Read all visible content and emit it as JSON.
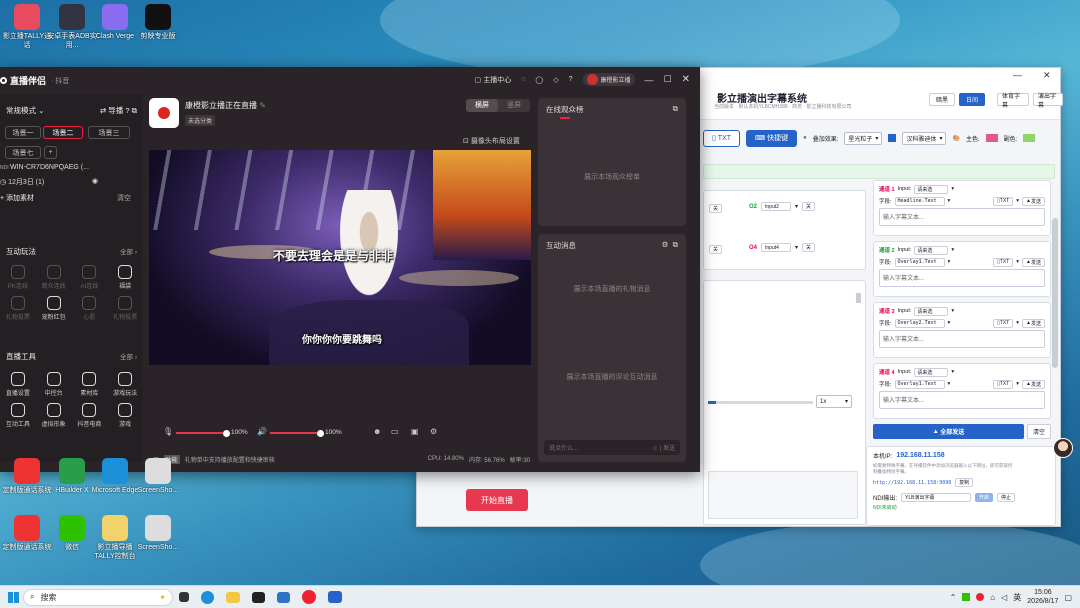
{
  "desktop": {
    "icons": [
      {
        "label": "影立播TALLY通话",
        "color": "#e84a5f"
      },
      {
        "label": "安卓手表ADB实用...",
        "color": "#334"
      },
      {
        "label": "Clash Verge",
        "color": "#8a6cf0"
      },
      {
        "label": "剪映专业版",
        "color": "#111"
      },
      {
        "label": "定制版通话系统",
        "color": "#e33"
      },
      {
        "label": "HBuilder X",
        "color": "#2a9d4a"
      },
      {
        "label": "Microsoft Edge",
        "color": "#1b8fd8"
      },
      {
        "label": "ScreenSho...",
        "color": "#ddd"
      },
      {
        "label": "定制版通话系统",
        "color": "#e33"
      },
      {
        "label": "微信",
        "color": "#2dc100"
      },
      {
        "label": "影立播导播TALLY控制台",
        "color": "#f2d36b"
      },
      {
        "label": "ScreenSho...",
        "color": "#ddd"
      }
    ]
  },
  "taskbar": {
    "search_label": "搜索",
    "tray_lang": "英",
    "time": "15:06",
    "date": "2026/8/17"
  },
  "live_app": {
    "title": "直播伴侣",
    "sub_title": "· 抖音",
    "header_links": [
      "主播中心"
    ],
    "user_name": "康橙影立播",
    "sidebar": {
      "mode_label": "常规模式",
      "guide_label": "导播",
      "scenes": [
        "场景一",
        "场景二",
        "场景三",
        "场景七"
      ],
      "active_scene": 1,
      "source_name": "WIN-CR7D6NPQAEG (...",
      "source_date": "12月3日 (1)",
      "add_material": "添加素材",
      "clear": "清空",
      "interact_title": "互动玩法",
      "all_label": "全部",
      "interact_items": [
        {
          "label": "PK连线",
          "dim": true
        },
        {
          "label": "观众连线",
          "dim": true
        },
        {
          "label": "AI连线",
          "dim": true
        },
        {
          "label": "福袋",
          "dim": false
        },
        {
          "label": "礼物投票",
          "dim": true
        },
        {
          "label": "宠粉红包",
          "dim": false
        },
        {
          "label": "心愿",
          "dim": true
        },
        {
          "label": "礼物投票",
          "dim": true
        }
      ],
      "tools_title": "直播工具",
      "tool_items": [
        "直播设置",
        "中控台",
        "素材库",
        "游戏玩法",
        "互动工具",
        "虚拟形象",
        "抖音电商",
        "游戏"
      ]
    },
    "stream": {
      "name": "康橙影立播正在直播",
      "category": "未选分类",
      "layout_label": "横屏",
      "layout_alt": "竖屏",
      "camera_settings": "摄像头布局设置",
      "subtitle_top": "不要去理会是是与非非",
      "subtitle_bottom": "你你你你要跳舞吗",
      "mic_volume": "100%",
      "speaker_volume": "100%",
      "mic_level": 1.0,
      "speaker_level": 1.0,
      "go_live": "开始直播",
      "notice": "礼物单中支持播放配置和快捷审核",
      "notice_tag": "功能",
      "cpu": "CPU: 14.80%",
      "mem": "内存: 56.76%",
      "fps": "帧率:30"
    },
    "right": {
      "viewers_title": "在线观众榜",
      "viewers_placeholder": "展示本场观众榜单",
      "msg_title": "互动消息",
      "gift_placeholder": "展示本场直播的礼物消息",
      "comment_placeholder": "展示本场直播的评论互动消息",
      "input_placeholder": "说点什么...",
      "send": "发送"
    }
  },
  "subtitle_app": {
    "title": "影立播演出字幕系统",
    "subtitle": "当前版本 · 默认本机YLBCMH388 · 商务 · 影立播科技有限公司",
    "theme_light": "暗黑",
    "theme_dark": "日间",
    "tab_a": "体育字幕",
    "tab_b": "演出字幕",
    "txt_btn": "TXT",
    "quick_btn": "快捷键",
    "overlay_label": "叠加效果:",
    "overlay_value": "星光粒子",
    "font_value": "汉科雅迪体",
    "main_color_label": "主色:",
    "main_color": "#e05a8c",
    "sub_color_label": "副色:",
    "sub_color": "#8fd46b",
    "outputs": [
      {
        "id": "O2",
        "value": "Input2",
        "btn": "关"
      },
      {
        "id": "O4",
        "value": "Input4",
        "btn": "关"
      }
    ],
    "left_btns": [
      "关",
      "关"
    ],
    "speed": "1x",
    "channels": [
      {
        "title": "通道 1",
        "green": false,
        "input": "请来选",
        "field": "Headline.Text",
        "placeholder": "输入字幕文本..."
      },
      {
        "title": "通道 2",
        "green": true,
        "input": "请来选",
        "field": "Overlay1.Text",
        "placeholder": "输入字幕文本..."
      },
      {
        "title": "通道 3",
        "green": false,
        "input": "请来选",
        "field": "Overlay2.Text",
        "placeholder": "输入字幕文本..."
      },
      {
        "title": "通道 4",
        "green": false,
        "input": "请来选",
        "field": "Overlay1.Text",
        "placeholder": "输入字幕文本..."
      }
    ],
    "input_label": "Input:",
    "field_label": "字段:",
    "txt_mini": "TXT",
    "send_mini": "发送",
    "send_all": "全部发送",
    "clear_all": "清空",
    "ip_label": "本机IP:",
    "ip": "192.168.11.158",
    "ip_hint": "如需要特殊字幕，在导播软件中添加浏览器输入以下网址，即可获取控制叠加特效字幕。",
    "url": "http://192.168.11.158:9090",
    "copy": "复制",
    "ndi_label": "NDI输出:",
    "ndi_value": "YLB演出字幕",
    "ndi_start": "开启",
    "ndi_stop": "停止",
    "ndi_status": "NDI未启动"
  }
}
